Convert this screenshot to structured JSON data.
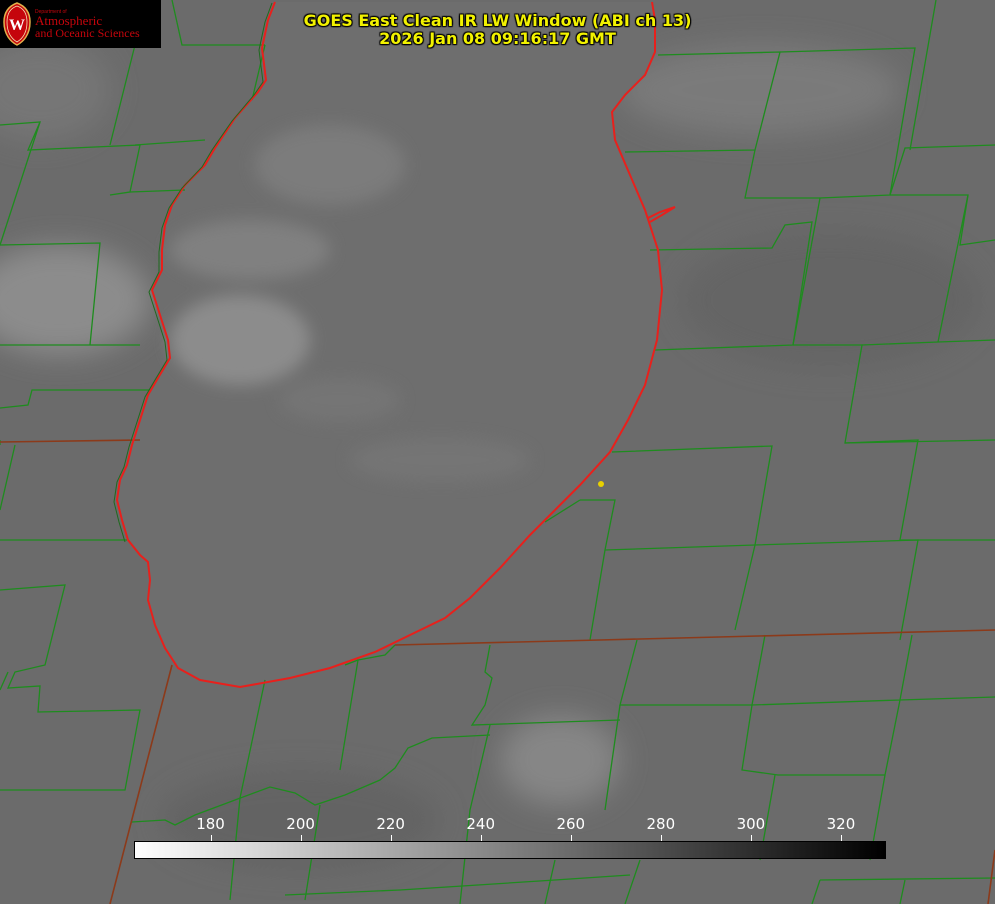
{
  "header": {
    "title_line1": "GOES East Clean IR LW Window (ABI ch 13)",
    "title_line2": "2026 Jan 08 09:16:17 GMT"
  },
  "logo": {
    "department": "Department of",
    "line1": "Atmospheric",
    "line2": "and Oceanic Sciences",
    "seal_letter": "W"
  },
  "colorbar": {
    "min": 163,
    "max": 330,
    "ticks": [
      "180",
      "200",
      "220",
      "240",
      "260",
      "280",
      "300",
      "320"
    ],
    "gradient_from": "#ffffff",
    "gradient_to": "#000000"
  },
  "colors": {
    "lake_shoreline": "#e8201c",
    "boundaries": "#1e8c1e",
    "state_lines": "#8c3a1a",
    "station_marker": "#e8d000",
    "title": "#f2f200"
  }
}
